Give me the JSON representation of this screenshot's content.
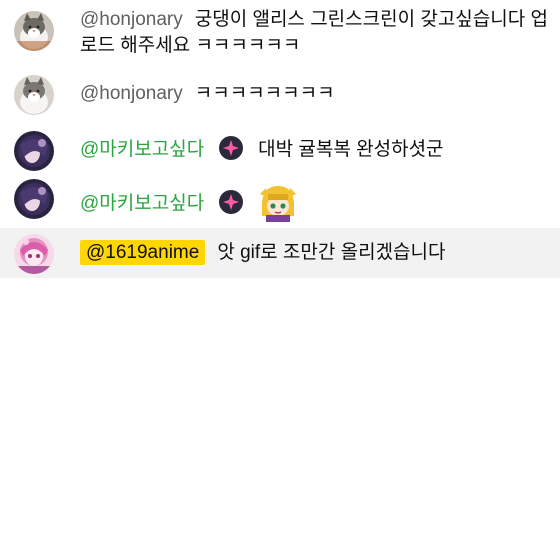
{
  "messages": [
    {
      "author": "@honjonary",
      "text": "궁댕이 앨리스 그린스크린이 갖고싶습니다 업로드 해주세요 ㅋㅋㅋㅋㅋㅋ",
      "author_type": "plain",
      "avatar": "cat-avatar"
    },
    {
      "author": "@honjonary",
      "text": "ㅋㅋㅋㅋㅋㅋㅋㅋ",
      "author_type": "plain",
      "avatar": "cat-avatar"
    },
    {
      "author": "@마키보고싶다",
      "text": "대박 귤복복 완성하셧군",
      "author_type": "member",
      "badge": "member-sparkle-badge",
      "avatar": "anime-dark-avatar"
    },
    {
      "author": "@마키보고싶다",
      "text": "",
      "author_type": "member",
      "badge": "member-sparkle-badge",
      "emote": "yellow-hair-character-emote",
      "avatar": "anime-dark-avatar"
    },
    {
      "author": "@1619anime",
      "text": "앗 gif로 조만간 올리겠습니다",
      "author_type": "owner",
      "avatar": "anime-pink-avatar",
      "highlighted": true
    }
  ],
  "colors": {
    "member_name": "#2ba640",
    "plain_name": "#606060",
    "owner_badge_bg": "#ffd600",
    "highlight_row": "#f2f2f2",
    "badge_circle": "#2a2a3a",
    "badge_sparkle": "#ff5aa5"
  }
}
